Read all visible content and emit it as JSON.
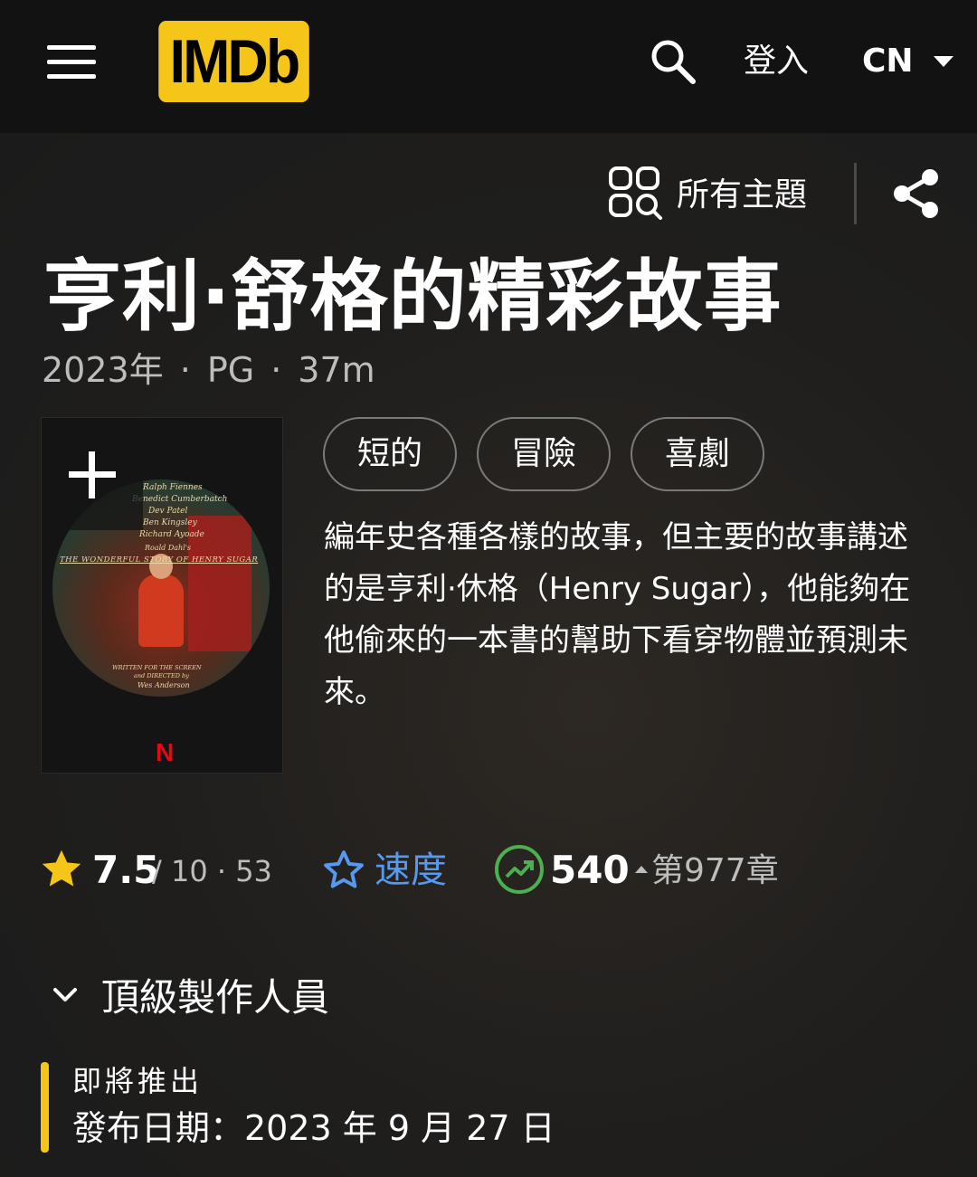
{
  "header": {
    "logo": "IMDb",
    "login_label": "登入",
    "language": "CN"
  },
  "toolbar": {
    "all_topics_label": "所有主題"
  },
  "title": {
    "name": "亨利·舒格的精彩故事",
    "year": "2023年",
    "rating_cert": "PG",
    "runtime": "37m"
  },
  "poster": {
    "credits": [
      "Ralph Fiennes",
      "Benedict Cumberbatch",
      "Dev Patel",
      "Ben Kingsley",
      "Richard Ayoade",
      "Roald Dahl's"
    ],
    "film_title": "THE WONDERFUL STORY OF HENRY SUGAR",
    "written_by": "WRITTEN FOR THE SCREEN",
    "directed_by": "and DIRECTED by",
    "director": "Wes Anderson",
    "studio_mark": "N"
  },
  "genres": [
    "短的",
    "冒險",
    "喜劇"
  ],
  "plot": "編年史各種各樣的故事，但主要的故事講述的是亨利·休格（Henry Sugar），他能夠在他偷來的一本書的幫助下看穿物體並預測未來。",
  "rating": {
    "value": "7.5",
    "max": "/ 10",
    "separator": "·",
    "votes": "53",
    "rate_label": "速度"
  },
  "popularity": {
    "value": "540",
    "rank_label": "第977章"
  },
  "crew": {
    "label": "頂級製作人員"
  },
  "release": {
    "status": "即將推出",
    "date": "發布日期：2023 年 9 月 27 日"
  },
  "colors": {
    "accent": "#f5c518",
    "link": "#5799ef",
    "trend": "#4caf50",
    "background": "#1f1f1f",
    "header": "#121212"
  }
}
